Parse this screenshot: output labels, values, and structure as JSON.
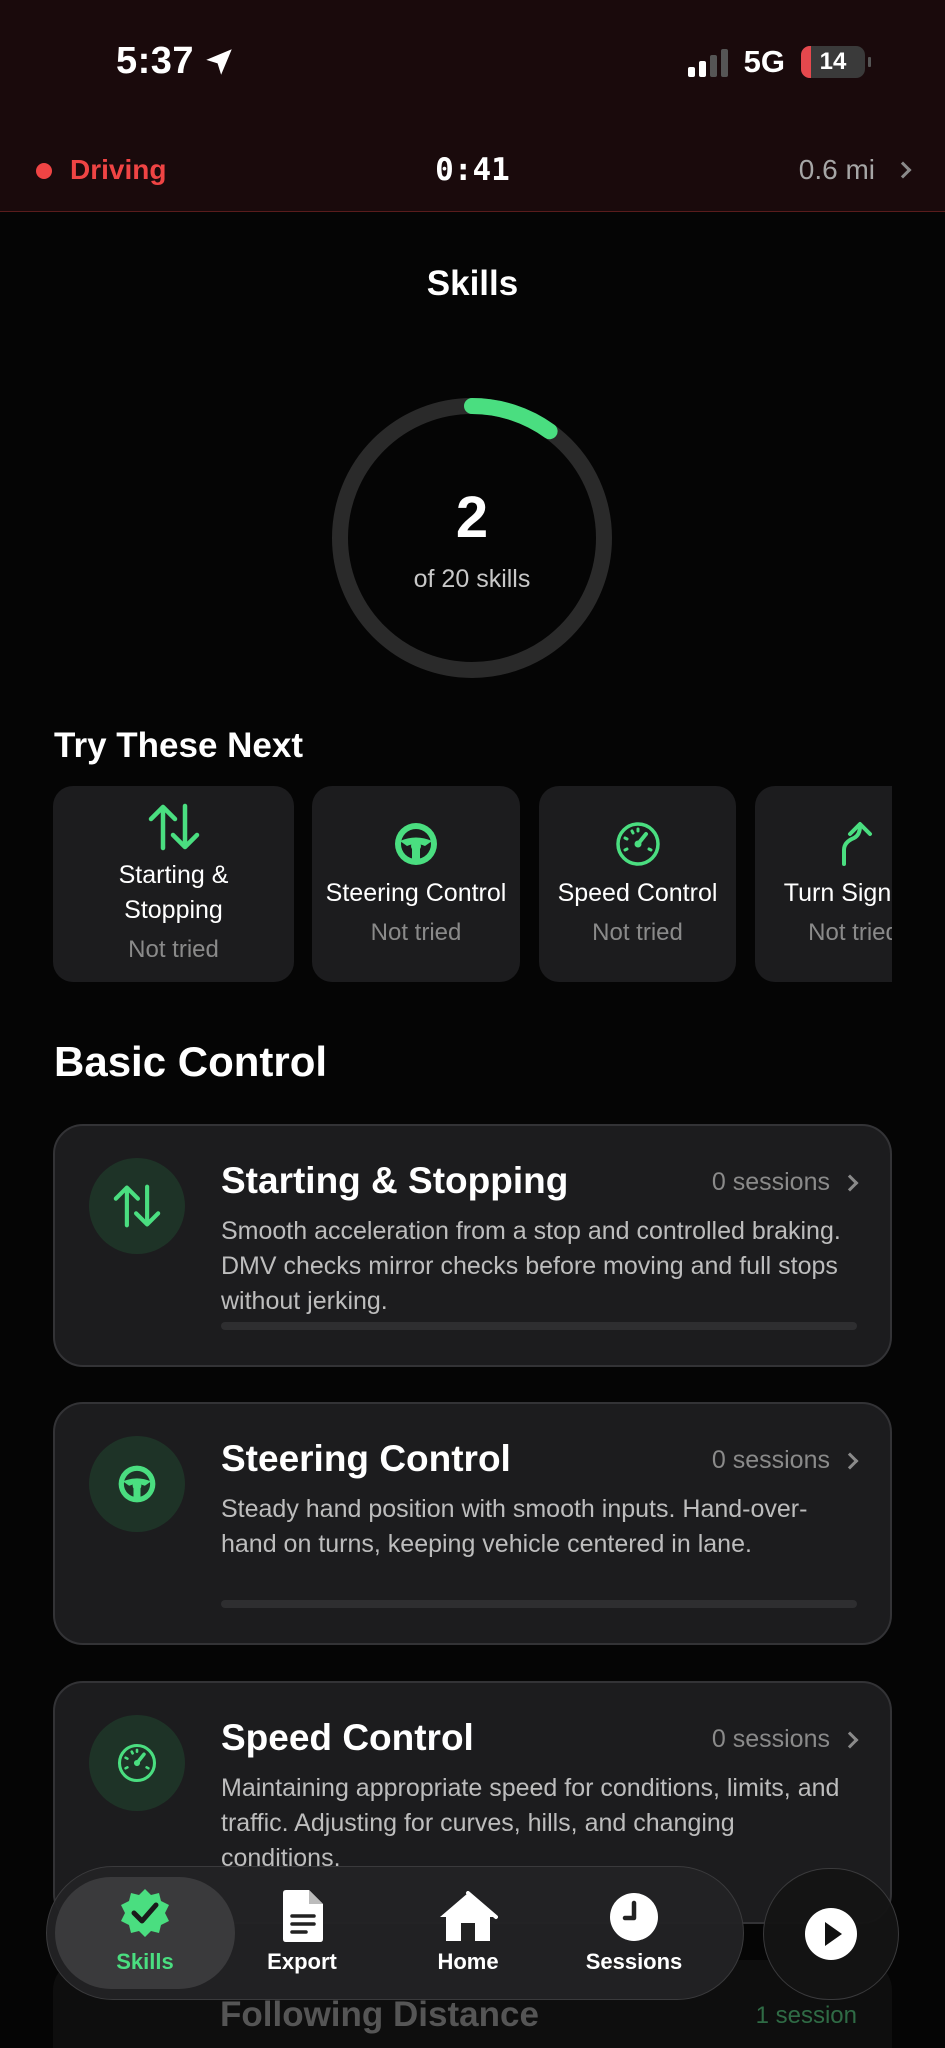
{
  "status_bar": {
    "time": "5:37",
    "network": "5G",
    "battery": "14"
  },
  "drive_bar": {
    "state": "Driving",
    "timer": "0:41",
    "distance": "0.6 mi"
  },
  "page": {
    "title": "Skills"
  },
  "progress": {
    "completed": "2",
    "caption": "of 20 skills",
    "fraction": 0.1
  },
  "try_next": {
    "heading": "Try These Next",
    "cards": [
      {
        "name_line1": "Starting &",
        "name_line2": "Stopping",
        "status": "Not tried",
        "icon": "arrows-up-down-icon"
      },
      {
        "name": "Steering Control",
        "status": "Not tried",
        "icon": "steering-wheel-icon"
      },
      {
        "name": "Speed Control",
        "status": "Not tried",
        "icon": "speedometer-icon"
      },
      {
        "name": "Turn Signals",
        "status": "Not tried",
        "icon": "turn-arrow-icon"
      }
    ]
  },
  "basic_control": {
    "heading": "Basic Control",
    "skills": [
      {
        "name": "Starting & Stopping",
        "sessions": "0 sessions",
        "description": "Smooth acceleration from a stop and controlled braking. DMV checks mirror checks before moving and full stops without jerking.",
        "icon": "arrows-up-down-icon"
      },
      {
        "name": "Steering Control",
        "sessions": "0 sessions",
        "description": "Steady hand position with smooth inputs. Hand-over-hand on turns, keeping vehicle centered in lane.",
        "icon": "steering-wheel-icon"
      },
      {
        "name": "Speed Control",
        "sessions": "0 sessions",
        "description": "Maintaining appropriate speed for conditions, limits, and traffic. Adjusting for curves, hills, and changing conditions.",
        "icon": "speedometer-icon"
      },
      {
        "name": "Following Distance",
        "sessions": "1 session"
      }
    ]
  },
  "tab_bar": {
    "tabs": [
      {
        "label": "Skills",
        "icon": "skills-badge-icon",
        "active": true
      },
      {
        "label": "Export",
        "icon": "document-icon"
      },
      {
        "label": "Home",
        "icon": "house-icon"
      },
      {
        "label": "Sessions",
        "icon": "clock-icon"
      }
    ],
    "play_icon": "play-icon"
  },
  "colors": {
    "accent": "#4ade80",
    "recording": "#ef4444",
    "card": "#1c1c1e",
    "background": "#050505"
  }
}
